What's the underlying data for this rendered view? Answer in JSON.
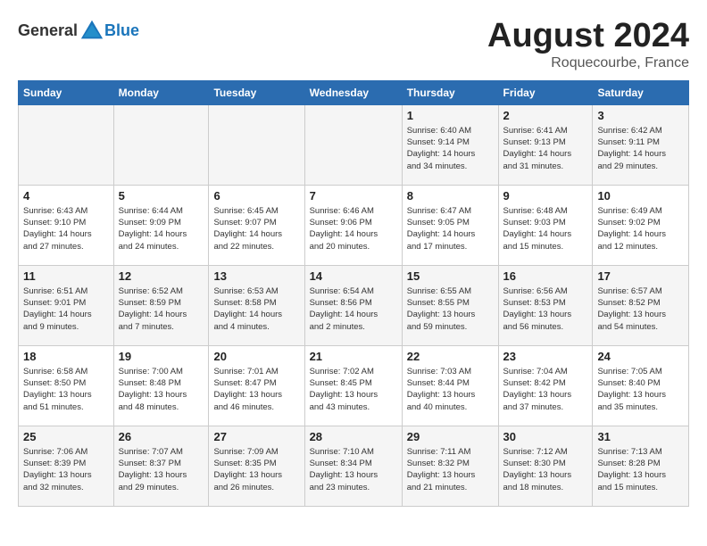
{
  "header": {
    "logo_general": "General",
    "logo_blue": "Blue",
    "month": "August 2024",
    "location": "Roquecourbe, France"
  },
  "weekdays": [
    "Sunday",
    "Monday",
    "Tuesday",
    "Wednesday",
    "Thursday",
    "Friday",
    "Saturday"
  ],
  "weeks": [
    [
      {
        "day": "",
        "detail": ""
      },
      {
        "day": "",
        "detail": ""
      },
      {
        "day": "",
        "detail": ""
      },
      {
        "day": "",
        "detail": ""
      },
      {
        "day": "1",
        "detail": "Sunrise: 6:40 AM\nSunset: 9:14 PM\nDaylight: 14 hours\nand 34 minutes."
      },
      {
        "day": "2",
        "detail": "Sunrise: 6:41 AM\nSunset: 9:13 PM\nDaylight: 14 hours\nand 31 minutes."
      },
      {
        "day": "3",
        "detail": "Sunrise: 6:42 AM\nSunset: 9:11 PM\nDaylight: 14 hours\nand 29 minutes."
      }
    ],
    [
      {
        "day": "4",
        "detail": "Sunrise: 6:43 AM\nSunset: 9:10 PM\nDaylight: 14 hours\nand 27 minutes."
      },
      {
        "day": "5",
        "detail": "Sunrise: 6:44 AM\nSunset: 9:09 PM\nDaylight: 14 hours\nand 24 minutes."
      },
      {
        "day": "6",
        "detail": "Sunrise: 6:45 AM\nSunset: 9:07 PM\nDaylight: 14 hours\nand 22 minutes."
      },
      {
        "day": "7",
        "detail": "Sunrise: 6:46 AM\nSunset: 9:06 PM\nDaylight: 14 hours\nand 20 minutes."
      },
      {
        "day": "8",
        "detail": "Sunrise: 6:47 AM\nSunset: 9:05 PM\nDaylight: 14 hours\nand 17 minutes."
      },
      {
        "day": "9",
        "detail": "Sunrise: 6:48 AM\nSunset: 9:03 PM\nDaylight: 14 hours\nand 15 minutes."
      },
      {
        "day": "10",
        "detail": "Sunrise: 6:49 AM\nSunset: 9:02 PM\nDaylight: 14 hours\nand 12 minutes."
      }
    ],
    [
      {
        "day": "11",
        "detail": "Sunrise: 6:51 AM\nSunset: 9:01 PM\nDaylight: 14 hours\nand 9 minutes."
      },
      {
        "day": "12",
        "detail": "Sunrise: 6:52 AM\nSunset: 8:59 PM\nDaylight: 14 hours\nand 7 minutes."
      },
      {
        "day": "13",
        "detail": "Sunrise: 6:53 AM\nSunset: 8:58 PM\nDaylight: 14 hours\nand 4 minutes."
      },
      {
        "day": "14",
        "detail": "Sunrise: 6:54 AM\nSunset: 8:56 PM\nDaylight: 14 hours\nand 2 minutes."
      },
      {
        "day": "15",
        "detail": "Sunrise: 6:55 AM\nSunset: 8:55 PM\nDaylight: 13 hours\nand 59 minutes."
      },
      {
        "day": "16",
        "detail": "Sunrise: 6:56 AM\nSunset: 8:53 PM\nDaylight: 13 hours\nand 56 minutes."
      },
      {
        "day": "17",
        "detail": "Sunrise: 6:57 AM\nSunset: 8:52 PM\nDaylight: 13 hours\nand 54 minutes."
      }
    ],
    [
      {
        "day": "18",
        "detail": "Sunrise: 6:58 AM\nSunset: 8:50 PM\nDaylight: 13 hours\nand 51 minutes."
      },
      {
        "day": "19",
        "detail": "Sunrise: 7:00 AM\nSunset: 8:48 PM\nDaylight: 13 hours\nand 48 minutes."
      },
      {
        "day": "20",
        "detail": "Sunrise: 7:01 AM\nSunset: 8:47 PM\nDaylight: 13 hours\nand 46 minutes."
      },
      {
        "day": "21",
        "detail": "Sunrise: 7:02 AM\nSunset: 8:45 PM\nDaylight: 13 hours\nand 43 minutes."
      },
      {
        "day": "22",
        "detail": "Sunrise: 7:03 AM\nSunset: 8:44 PM\nDaylight: 13 hours\nand 40 minutes."
      },
      {
        "day": "23",
        "detail": "Sunrise: 7:04 AM\nSunset: 8:42 PM\nDaylight: 13 hours\nand 37 minutes."
      },
      {
        "day": "24",
        "detail": "Sunrise: 7:05 AM\nSunset: 8:40 PM\nDaylight: 13 hours\nand 35 minutes."
      }
    ],
    [
      {
        "day": "25",
        "detail": "Sunrise: 7:06 AM\nSunset: 8:39 PM\nDaylight: 13 hours\nand 32 minutes."
      },
      {
        "day": "26",
        "detail": "Sunrise: 7:07 AM\nSunset: 8:37 PM\nDaylight: 13 hours\nand 29 minutes."
      },
      {
        "day": "27",
        "detail": "Sunrise: 7:09 AM\nSunset: 8:35 PM\nDaylight: 13 hours\nand 26 minutes."
      },
      {
        "day": "28",
        "detail": "Sunrise: 7:10 AM\nSunset: 8:34 PM\nDaylight: 13 hours\nand 23 minutes."
      },
      {
        "day": "29",
        "detail": "Sunrise: 7:11 AM\nSunset: 8:32 PM\nDaylight: 13 hours\nand 21 minutes."
      },
      {
        "day": "30",
        "detail": "Sunrise: 7:12 AM\nSunset: 8:30 PM\nDaylight: 13 hours\nand 18 minutes."
      },
      {
        "day": "31",
        "detail": "Sunrise: 7:13 AM\nSunset: 8:28 PM\nDaylight: 13 hours\nand 15 minutes."
      }
    ]
  ]
}
